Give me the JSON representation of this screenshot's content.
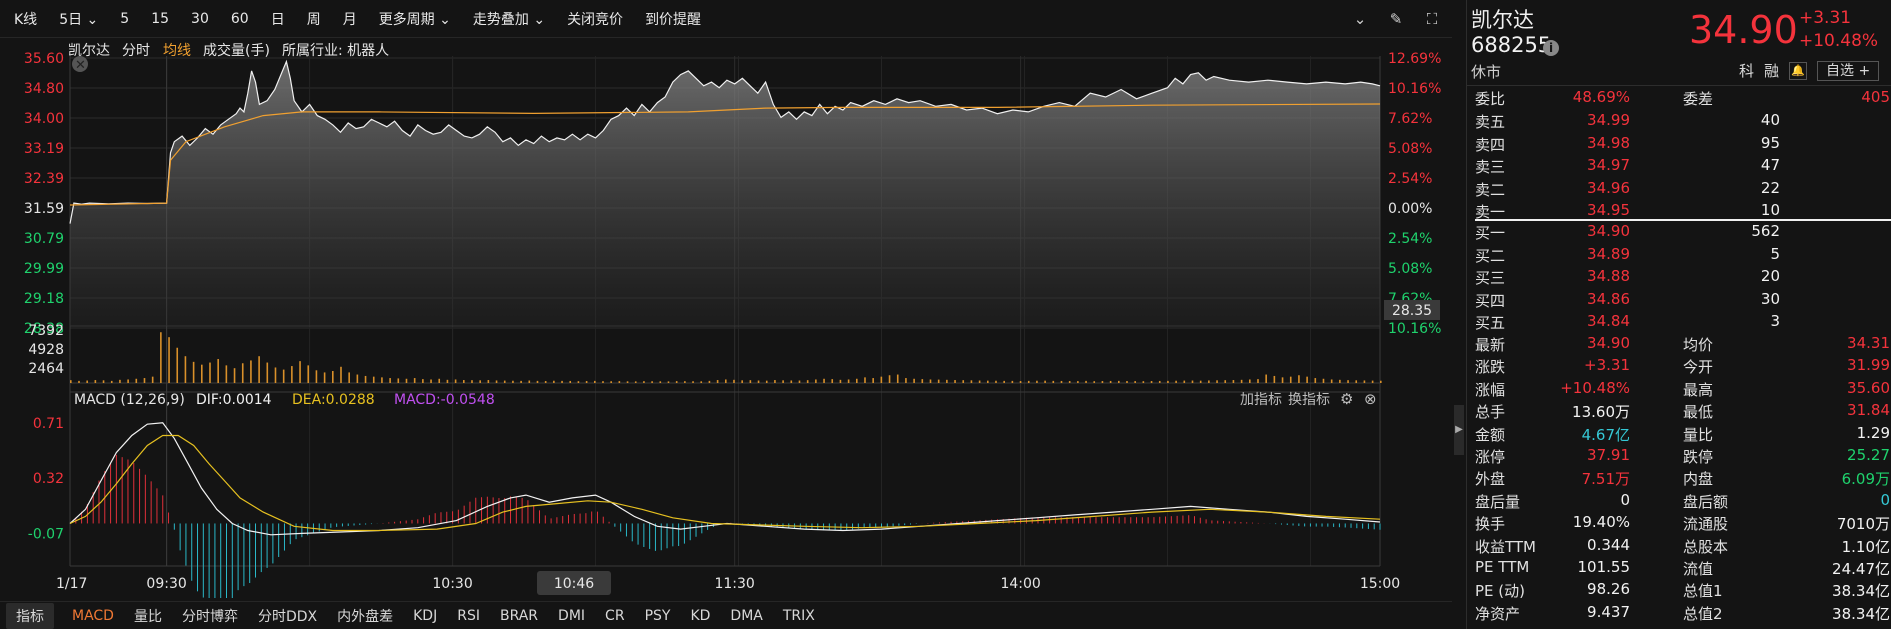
{
  "toolbar": {
    "items": [
      "K线",
      "5日 ⌄",
      "5",
      "15",
      "30",
      "60",
      "日",
      "周",
      "月",
      "更多周期 ⌄",
      "走势叠加 ⌄",
      "关闭竞价",
      "到价提醒"
    ]
  },
  "chart_header": {
    "name": "凯尔达",
    "mode": "分时",
    "avg_label": "均线",
    "volume_label": "成交量(手)",
    "industry": "所属行业: 机器人"
  },
  "chart_data": {
    "type": "line",
    "price_axis": [
      "35.60",
      "34.80",
      "34.00",
      "33.19",
      "32.39",
      "31.59",
      "30.79",
      "29.99",
      "29.18",
      "28.38"
    ],
    "pct_axis": [
      "12.69%",
      "10.16%",
      "7.62%",
      "5.08%",
      "2.54%",
      "0.00%",
      "2.54%",
      "5.08%",
      "7.62%",
      "10.16%"
    ],
    "ylim": [
      28.35,
      35.6
    ],
    "prev_close": 31.59,
    "current_label": "28.35",
    "time_labels": [
      "09:30",
      "10:30",
      "11:30",
      "14:00",
      "15:00"
    ],
    "date_label": "1/17",
    "cursor_label": "10:46",
    "price_series": [
      [
        0,
        31.1
      ],
      [
        1,
        31.65
      ],
      [
        3,
        31.62
      ],
      [
        5,
        31.65
      ],
      [
        10,
        31.63
      ],
      [
        15,
        31.65
      ],
      [
        20,
        31.64
      ],
      [
        25,
        31.65
      ],
      [
        26,
        33.0
      ],
      [
        27,
        33.3
      ],
      [
        29,
        33.45
      ],
      [
        31,
        33.2
      ],
      [
        33,
        33.4
      ],
      [
        35,
        33.65
      ],
      [
        37,
        33.5
      ],
      [
        39,
        33.75
      ],
      [
        41,
        33.9
      ],
      [
        43,
        34.05
      ],
      [
        44,
        34.2
      ],
      [
        45,
        34.1
      ],
      [
        46,
        34.6
      ],
      [
        47,
        35.2
      ],
      [
        48,
        34.9
      ],
      [
        49,
        34.3
      ],
      [
        51,
        34.4
      ],
      [
        53,
        34.7
      ],
      [
        55,
        35.2
      ],
      [
        56,
        35.45
      ],
      [
        57,
        35.0
      ],
      [
        58,
        34.4
      ],
      [
        60,
        34.1
      ],
      [
        62,
        34.3
      ],
      [
        64,
        34.0
      ],
      [
        66,
        33.9
      ],
      [
        68,
        33.75
      ],
      [
        70,
        33.55
      ],
      [
        72,
        33.8
      ],
      [
        74,
        33.65
      ],
      [
        76,
        33.7
      ],
      [
        78,
        33.9
      ],
      [
        80,
        33.8
      ],
      [
        82,
        33.7
      ],
      [
        84,
        33.85
      ],
      [
        86,
        33.6
      ],
      [
        88,
        33.45
      ],
      [
        90,
        33.75
      ],
      [
        92,
        33.6
      ],
      [
        94,
        33.5
      ],
      [
        96,
        33.55
      ],
      [
        98,
        33.75
      ],
      [
        100,
        33.6
      ],
      [
        102,
        33.45
      ],
      [
        104,
        33.4
      ],
      [
        106,
        33.5
      ],
      [
        108,
        33.7
      ],
      [
        110,
        33.55
      ],
      [
        112,
        33.3
      ],
      [
        114,
        33.4
      ],
      [
        116,
        33.2
      ],
      [
        118,
        33.35
      ],
      [
        120,
        33.25
      ],
      [
        122,
        33.45
      ],
      [
        124,
        33.3
      ],
      [
        126,
        33.4
      ],
      [
        128,
        33.35
      ],
      [
        130,
        33.5
      ],
      [
        132,
        33.35
      ],
      [
        134,
        33.5
      ],
      [
        136,
        33.4
      ],
      [
        138,
        33.6
      ],
      [
        140,
        33.9
      ],
      [
        142,
        34.0
      ],
      [
        144,
        34.2
      ],
      [
        146,
        34.0
      ],
      [
        148,
        34.3
      ],
      [
        150,
        34.1
      ],
      [
        152,
        34.35
      ],
      [
        154,
        34.5
      ],
      [
        156,
        34.9
      ],
      [
        158,
        35.1
      ],
      [
        160,
        35.2
      ],
      [
        162,
        35.0
      ],
      [
        164,
        34.8
      ],
      [
        166,
        34.9
      ],
      [
        168,
        34.75
      ],
      [
        170,
        34.95
      ],
      [
        172,
        34.85
      ],
      [
        174,
        35.0
      ],
      [
        176,
        34.8
      ],
      [
        178,
        34.6
      ],
      [
        180,
        34.9
      ],
      [
        182,
        34.3
      ],
      [
        184,
        33.95
      ],
      [
        186,
        34.1
      ],
      [
        188,
        33.9
      ],
      [
        190,
        34.1
      ],
      [
        192,
        34.0
      ],
      [
        194,
        34.3
      ],
      [
        196,
        34.05
      ],
      [
        198,
        34.25
      ],
      [
        200,
        34.15
      ],
      [
        202,
        34.35
      ],
      [
        205,
        34.25
      ],
      [
        208,
        34.4
      ],
      [
        211,
        34.3
      ],
      [
        214,
        34.45
      ],
      [
        217,
        34.35
      ],
      [
        220,
        34.4
      ],
      [
        224,
        34.25
      ],
      [
        228,
        34.3
      ],
      [
        232,
        34.15
      ],
      [
        236,
        34.2
      ],
      [
        240,
        34.05
      ],
      [
        244,
        34.15
      ],
      [
        248,
        34.1
      ],
      [
        252,
        34.25
      ],
      [
        256,
        34.35
      ],
      [
        260,
        34.25
      ],
      [
        264,
        34.6
      ],
      [
        268,
        34.5
      ],
      [
        272,
        34.7
      ],
      [
        276,
        34.45
      ],
      [
        280,
        34.6
      ],
      [
        284,
        34.75
      ],
      [
        286,
        35.0
      ],
      [
        288,
        34.85
      ],
      [
        290,
        35.1
      ],
      [
        292,
        35.15
      ],
      [
        294,
        34.95
      ],
      [
        296,
        35.05
      ],
      [
        300,
        34.95
      ],
      [
        305,
        34.9
      ],
      [
        310,
        34.95
      ],
      [
        315,
        34.9
      ],
      [
        320,
        34.85
      ],
      [
        325,
        34.9
      ],
      [
        330,
        34.85
      ],
      [
        334,
        34.9
      ],
      [
        337,
        34.85
      ],
      [
        339,
        34.8
      ]
    ],
    "avg_series": [
      [
        0,
        31.6
      ],
      [
        25,
        31.65
      ],
      [
        26,
        32.8
      ],
      [
        30,
        33.3
      ],
      [
        40,
        33.7
      ],
      [
        50,
        34.0
      ],
      [
        60,
        34.1
      ],
      [
        80,
        34.1
      ],
      [
        120,
        34.06
      ],
      [
        160,
        34.1
      ],
      [
        180,
        34.2
      ],
      [
        200,
        34.22
      ],
      [
        240,
        34.22
      ],
      [
        280,
        34.28
      ],
      [
        339,
        34.31
      ]
    ],
    "volume_axis": [
      "7392",
      "4928",
      "2464"
    ],
    "volume_series": [
      400,
      300,
      350,
      420,
      380,
      300,
      450,
      500,
      600,
      700,
      900,
      7200,
      6500,
      5000,
      3800,
      3000,
      2600,
      2900,
      3400,
      2500,
      2100,
      2800,
      3200,
      3800,
      2900,
      2200,
      1900,
      2400,
      3100,
      2500,
      1800,
      1500,
      1700,
      2300,
      1500,
      1200,
      1000,
      900,
      800,
      700,
      650,
      600,
      700,
      550,
      500,
      600,
      450,
      500,
      420,
      400,
      380,
      420,
      360,
      340,
      320,
      300,
      350,
      300,
      280,
      320,
      300,
      290,
      260,
      280,
      300,
      260,
      250,
      270,
      240,
      230,
      260,
      250,
      240,
      230,
      270,
      260,
      250,
      240,
      300,
      420,
      500,
      450,
      380,
      400,
      350,
      330,
      420,
      380,
      360,
      350,
      400,
      500,
      600,
      550,
      450,
      500,
      600,
      800,
      700,
      900,
      1100,
      1200,
      700,
      600,
      550,
      500,
      480,
      450,
      420,
      400,
      380,
      350,
      330,
      320,
      300,
      300,
      280,
      300,
      320,
      330,
      300,
      290,
      280,
      270,
      300,
      260,
      280,
      290,
      300,
      280,
      270,
      260,
      280,
      290,
      300,
      320,
      340,
      350,
      330,
      360,
      380,
      400,
      420,
      450,
      500,
      550,
      1200,
      1000,
      800,
      900,
      1100,
      900,
      700,
      600,
      500,
      450,
      400,
      380,
      360,
      340,
      320
    ],
    "macd": {
      "label": "MACD (12,26,9)",
      "dif": "DIF:0.0014",
      "dea": "DEA:0.0288",
      "macd": "MACD:-0.0548",
      "axis": [
        "0.71",
        "0.32",
        "-0.07"
      ],
      "add_label": "加指标",
      "switch_label": "换指标"
    },
    "dif_series": [
      [
        0,
        0
      ],
      [
        4,
        0.1
      ],
      [
        8,
        0.3
      ],
      [
        12,
        0.5
      ],
      [
        16,
        0.62
      ],
      [
        20,
        0.7
      ],
      [
        24,
        0.71
      ],
      [
        27,
        0.6
      ],
      [
        30,
        0.45
      ],
      [
        34,
        0.25
      ],
      [
        38,
        0.1
      ],
      [
        42,
        0.0
      ],
      [
        46,
        -0.05
      ],
      [
        52,
        -0.08
      ],
      [
        60,
        -0.07
      ],
      [
        70,
        -0.06
      ],
      [
        80,
        -0.05
      ],
      [
        90,
        -0.03
      ],
      [
        100,
        0.02
      ],
      [
        108,
        0.12
      ],
      [
        114,
        0.18
      ],
      [
        118,
        0.2
      ],
      [
        124,
        0.15
      ],
      [
        130,
        0.18
      ],
      [
        136,
        0.2
      ],
      [
        140,
        0.15
      ],
      [
        146,
        0.05
      ],
      [
        152,
        -0.02
      ],
      [
        158,
        -0.04
      ],
      [
        164,
        -0.02
      ],
      [
        170,
        0.0
      ],
      [
        180,
        -0.02
      ],
      [
        190,
        -0.04
      ],
      [
        200,
        -0.05
      ],
      [
        210,
        -0.04
      ],
      [
        220,
        -0.02
      ],
      [
        230,
        0.0
      ],
      [
        240,
        0.02
      ],
      [
        250,
        0.04
      ],
      [
        260,
        0.06
      ],
      [
        270,
        0.08
      ],
      [
        280,
        0.1
      ],
      [
        290,
        0.12
      ],
      [
        300,
        0.1
      ],
      [
        310,
        0.08
      ],
      [
        320,
        0.05
      ],
      [
        330,
        0.03
      ],
      [
        339,
        0.01
      ]
    ],
    "dea_series": [
      [
        0,
        0
      ],
      [
        4,
        0.05
      ],
      [
        8,
        0.15
      ],
      [
        12,
        0.28
      ],
      [
        16,
        0.42
      ],
      [
        20,
        0.55
      ],
      [
        24,
        0.62
      ],
      [
        28,
        0.62
      ],
      [
        32,
        0.55
      ],
      [
        36,
        0.42
      ],
      [
        40,
        0.3
      ],
      [
        44,
        0.18
      ],
      [
        50,
        0.08
      ],
      [
        58,
        -0.02
      ],
      [
        68,
        -0.05
      ],
      [
        80,
        -0.05
      ],
      [
        95,
        -0.04
      ],
      [
        105,
        0.0
      ],
      [
        112,
        0.08
      ],
      [
        118,
        0.12
      ],
      [
        126,
        0.14
      ],
      [
        134,
        0.16
      ],
      [
        140,
        0.15
      ],
      [
        148,
        0.1
      ],
      [
        156,
        0.04
      ],
      [
        166,
        0.0
      ],
      [
        178,
        -0.01
      ],
      [
        190,
        -0.02
      ],
      [
        205,
        -0.03
      ],
      [
        220,
        -0.02
      ],
      [
        235,
        0.0
      ],
      [
        250,
        0.02
      ],
      [
        265,
        0.05
      ],
      [
        280,
        0.08
      ],
      [
        295,
        0.1
      ],
      [
        310,
        0.08
      ],
      [
        325,
        0.05
      ],
      [
        339,
        0.03
      ]
    ]
  },
  "bottom_tabs": [
    "指标",
    "MACD",
    "量比",
    "分时博弈",
    "分时DDX",
    "内外盘差",
    "KDJ",
    "RSI",
    "BRAR",
    "DMI",
    "CR",
    "PSY",
    "KD",
    "DMA",
    "TRIX"
  ],
  "quote": {
    "name": "凯尔达",
    "code": "688255",
    "status": "休市",
    "price": "34.90",
    "change": "+3.31",
    "change_pct": "+10.48%",
    "tags": [
      "科",
      "融"
    ],
    "watch_label": "自选 +",
    "weibi": {
      "label": "委比",
      "value": "48.69%",
      "label2": "委差",
      "value2": "405"
    },
    "asks": [
      {
        "label": "卖五",
        "price": "34.99",
        "vol": "40"
      },
      {
        "label": "卖四",
        "price": "34.98",
        "vol": "95"
      },
      {
        "label": "卖三",
        "price": "34.97",
        "vol": "47"
      },
      {
        "label": "卖二",
        "price": "34.96",
        "vol": "22"
      },
      {
        "label": "卖一",
        "price": "34.95",
        "vol": "10"
      }
    ],
    "bids": [
      {
        "label": "买一",
        "price": "34.90",
        "vol": "562"
      },
      {
        "label": "买二",
        "price": "34.89",
        "vol": "5"
      },
      {
        "label": "买三",
        "price": "34.88",
        "vol": "20"
      },
      {
        "label": "买四",
        "price": "34.86",
        "vol": "30"
      },
      {
        "label": "买五",
        "price": "34.84",
        "vol": "3"
      }
    ],
    "stats": [
      {
        "l1": "最新",
        "v1": "34.90",
        "c1": "red",
        "l2": "均价",
        "v2": "34.31",
        "c2": "red"
      },
      {
        "l1": "涨跌",
        "v1": "+3.31",
        "c1": "red",
        "l2": "今开",
        "v2": "31.99",
        "c2": "red"
      },
      {
        "l1": "涨幅",
        "v1": "+10.48%",
        "c1": "red",
        "l2": "最高",
        "v2": "35.60",
        "c2": "red"
      },
      {
        "l1": "总手",
        "v1": "13.60万",
        "c1": "white",
        "l2": "最低",
        "v2": "31.84",
        "c2": "red"
      },
      {
        "l1": "金额",
        "v1": "4.67亿",
        "c1": "cyan",
        "l2": "量比",
        "v2": "1.29",
        "c2": "white"
      },
      {
        "l1": "涨停",
        "v1": "37.91",
        "c1": "red",
        "l2": "跌停",
        "v2": "25.27",
        "c2": "green"
      },
      {
        "l1": "外盘",
        "v1": "7.51万",
        "c1": "red",
        "l2": "内盘",
        "v2": "6.09万",
        "c2": "green"
      },
      {
        "l1": "盘后量",
        "v1": "0",
        "c1": "white",
        "l2": "盘后额",
        "v2": "0",
        "c2": "cyan"
      },
      {
        "l1": "换手",
        "v1": "19.40%",
        "c1": "white",
        "l2": "流通股",
        "v2": "7010万",
        "c2": "white"
      },
      {
        "l1": "收益TTM",
        "v1": "0.344",
        "c1": "white",
        "l2": "总股本",
        "v2": "1.10亿",
        "c2": "white"
      },
      {
        "l1": "PE TTM",
        "v1": "101.55",
        "c1": "white",
        "l2": "流值",
        "v2": "24.47亿",
        "c2": "white"
      },
      {
        "l1": "PE (动)",
        "v1": "98.26",
        "c1": "white",
        "l2": "总值1",
        "v2": "38.34亿",
        "c2": "white"
      },
      {
        "l1": "净资产",
        "v1": "9.437",
        "c1": "white",
        "l2": "总值2",
        "v2": "38.34亿",
        "c2": "white"
      }
    ]
  },
  "colors": {
    "up": "#f4333c",
    "down": "#1fd26d",
    "avg": "#f0a030",
    "price_line": "#f0f0f0",
    "dif": "#f2f2f2",
    "dea": "#e6c020",
    "macd_label": "#c050f0"
  }
}
